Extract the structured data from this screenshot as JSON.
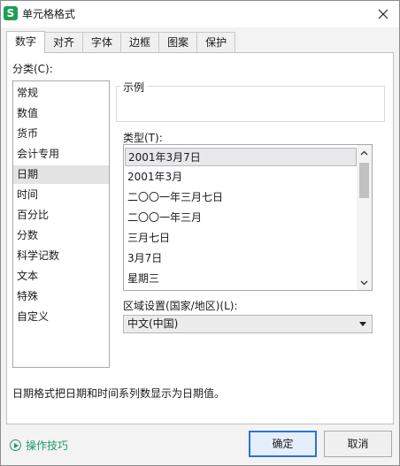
{
  "window": {
    "app_icon_letter": "S",
    "title": "单元格格式"
  },
  "tabs": [
    {
      "label": "数字",
      "active": true
    },
    {
      "label": "对齐",
      "active": false
    },
    {
      "label": "字体",
      "active": false
    },
    {
      "label": "边框",
      "active": false
    },
    {
      "label": "图案",
      "active": false
    },
    {
      "label": "保护",
      "active": false
    }
  ],
  "category": {
    "label": "分类(C):",
    "items": [
      "常规",
      "数值",
      "货币",
      "会计专用",
      "日期",
      "时间",
      "百分比",
      "分数",
      "科学记数",
      "文本",
      "特殊",
      "自定义"
    ],
    "selected_index": 4
  },
  "sample": {
    "legend": "示例",
    "value": ""
  },
  "type": {
    "label": "类型(T):",
    "items": [
      "2001年3月7日",
      "2001年3月",
      "二〇〇一年三月七日",
      "二〇〇一年三月",
      "三月七日",
      "3月7日",
      "星期三"
    ],
    "selected_index": 0
  },
  "region": {
    "label": "区域设置(国家/地区)(L):",
    "value": "中文(中国)"
  },
  "description": "日期格式把日期和时间系列数显示为日期值。",
  "footer": {
    "tips_label": "操作技巧",
    "ok_label": "确定",
    "cancel_label": "取消"
  },
  "colors": {
    "accent": "#2b74d3",
    "app_icon": "#1e9f55",
    "link": "#1e9a6a"
  },
  "icons": {
    "app": "spreadsheet-app-icon",
    "close": "close-icon",
    "scroll_up": "chevron-up-icon",
    "scroll_down": "chevron-down-icon",
    "select_arrow": "triangle-down-icon",
    "tips": "play-circle-icon"
  }
}
